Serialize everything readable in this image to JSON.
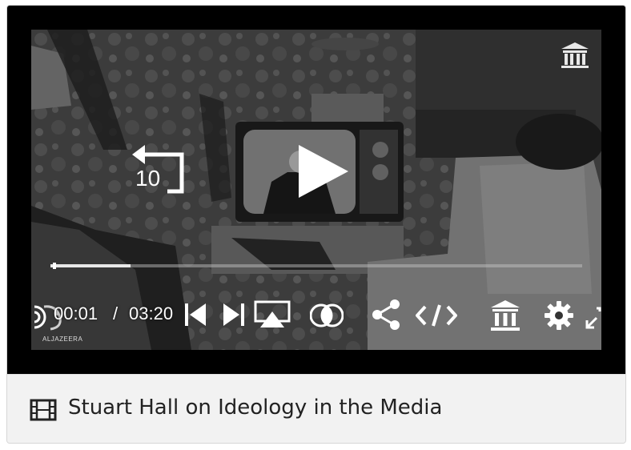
{
  "player": {
    "current_time": "00:01",
    "separator": "/",
    "duration": "03:20",
    "progress": 0.005,
    "buffered": 0.15,
    "replay_amount": "10",
    "watermark": "ALJAZEERA"
  },
  "caption": {
    "title": "Stuart Hall on Ideology in the Media"
  },
  "colors": {
    "player_bg": "#000000",
    "caption_bg": "#f2f2f2",
    "control_fg": "#ffffff"
  }
}
